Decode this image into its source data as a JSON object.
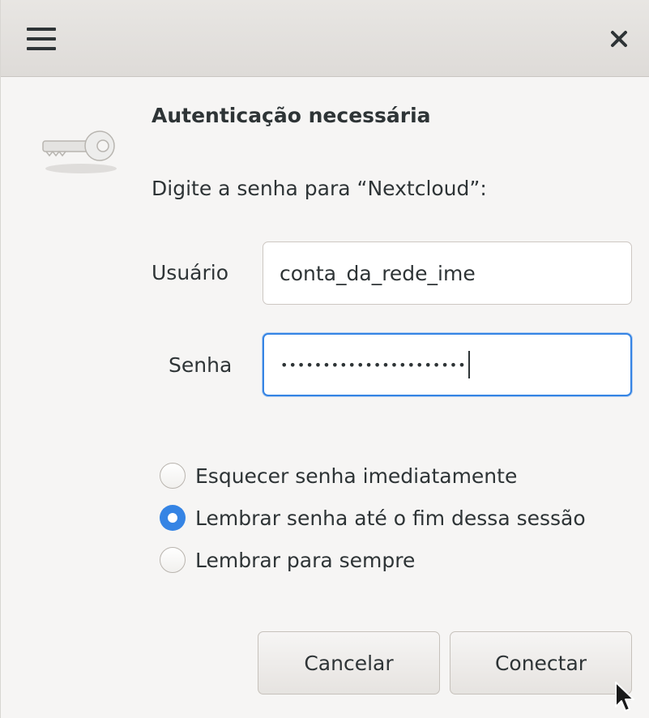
{
  "titlebar": {
    "menu_icon": "hamburger-menu-icon",
    "close_icon": "close-icon"
  },
  "dialog": {
    "icon": "key-icon",
    "heading": "Autenticação necessária",
    "prompt": "Digite a senha para “Nextcloud”:"
  },
  "form": {
    "username_label": "Usuário",
    "username_value": "conta_da_rede_ime",
    "password_label": "Senha",
    "password_value": "••••••••••••••••••••••"
  },
  "remember_options": [
    {
      "label": "Esquecer senha imediatamente",
      "selected": false
    },
    {
      "label": "Lembrar senha até o fim dessa sessão",
      "selected": true
    },
    {
      "label": "Lembrar para sempre",
      "selected": false
    }
  ],
  "buttons": {
    "cancel": "Cancelar",
    "connect": "Conectar"
  },
  "colors": {
    "accent": "#3584e4",
    "background": "#f6f5f4",
    "titlebar": "#e3e1de",
    "text": "#2e3436"
  }
}
